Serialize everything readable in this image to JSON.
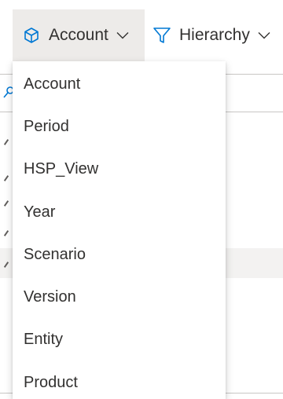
{
  "toolbar": {
    "account_button": {
      "label": "Account",
      "icon": "cube-icon"
    },
    "hierarchy_button": {
      "label": "Hierarchy",
      "icon": "funnel-icon"
    }
  },
  "dimension_menu": {
    "items": [
      {
        "label": "Account"
      },
      {
        "label": "Period"
      },
      {
        "label": "HSP_View"
      },
      {
        "label": "Year"
      },
      {
        "label": "Scenario"
      },
      {
        "label": "Version"
      },
      {
        "label": "Entity"
      },
      {
        "label": "Product"
      }
    ]
  },
  "colors": {
    "selected_button_bg": "#edebe9",
    "accent_icon": "#0078d4",
    "text": "#323130"
  }
}
